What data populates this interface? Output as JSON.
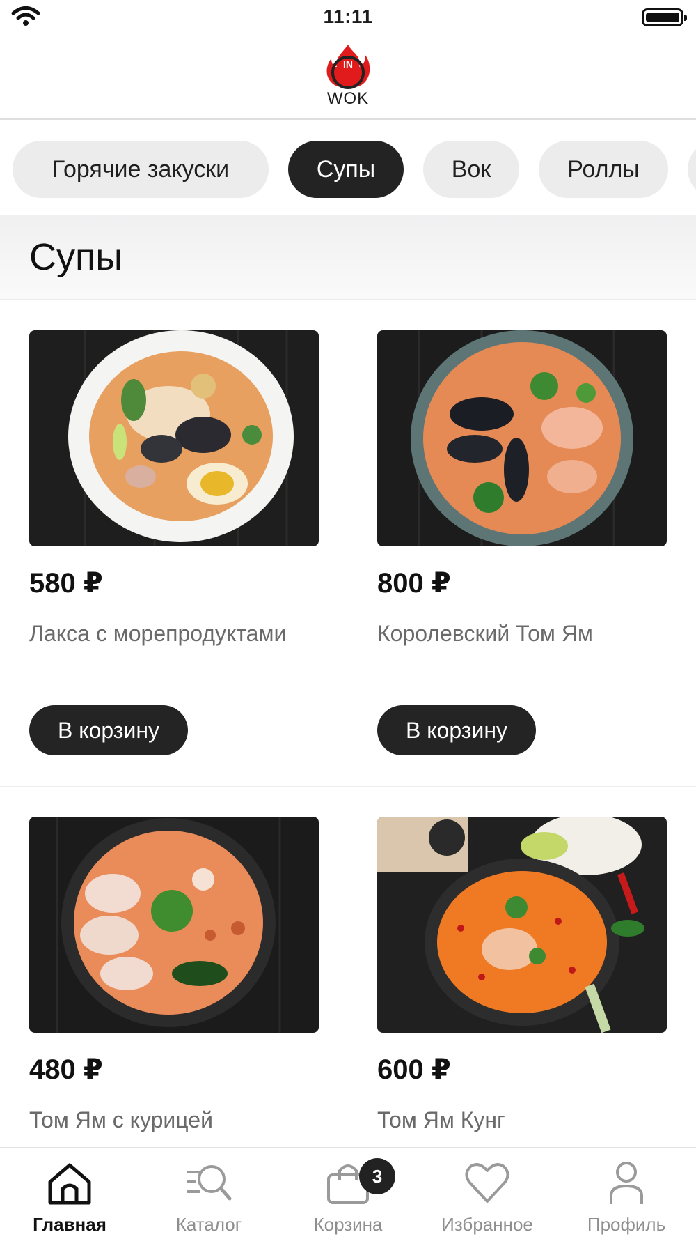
{
  "status_bar": {
    "time": "11:11"
  },
  "header": {
    "logo_text": "WOK",
    "logo_badge": "IN"
  },
  "categories": [
    {
      "label": "Горячие закуски",
      "active": false
    },
    {
      "label": "Супы",
      "active": true
    },
    {
      "label": "Вок",
      "active": false
    },
    {
      "label": "Роллы",
      "active": false
    }
  ],
  "section": {
    "title": "Супы"
  },
  "products": [
    {
      "price": "580 ₽",
      "name": "Лакса с морепродуктами",
      "button": "В корзину"
    },
    {
      "price": "800 ₽",
      "name": "Королевский Том Ям",
      "button": "В корзину"
    },
    {
      "price": "480 ₽",
      "name": "Том Ям с курицей"
    },
    {
      "price": "600 ₽",
      "name": "Том Ям Кунг"
    }
  ],
  "tabbar": {
    "items": [
      {
        "label": "Главная",
        "icon": "home-icon",
        "active": true
      },
      {
        "label": "Каталог",
        "icon": "catalog-search-icon",
        "active": false
      },
      {
        "label": "Корзина",
        "icon": "bag-icon",
        "active": false,
        "badge": "3"
      },
      {
        "label": "Избранное",
        "icon": "heart-icon",
        "active": false
      },
      {
        "label": "Профиль",
        "icon": "profile-icon",
        "active": false
      }
    ]
  },
  "colors": {
    "accent_dark": "#232323",
    "chip_bg": "#ececec",
    "logo_red": "#e11b1b",
    "text_muted": "#6a6a6a"
  }
}
